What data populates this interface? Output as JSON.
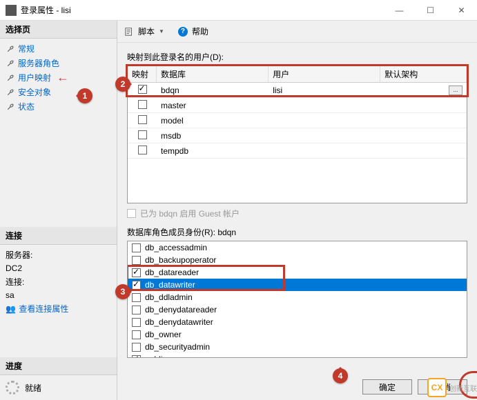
{
  "window": {
    "title": "登录属性 - lisi",
    "minimize": "—",
    "maximize": "☐",
    "close": "✕"
  },
  "left": {
    "select_page": "选择页",
    "nav": [
      {
        "label": "常规"
      },
      {
        "label": "服务器角色"
      },
      {
        "label": "用户映射"
      },
      {
        "label": "安全对象"
      },
      {
        "label": "状态"
      }
    ],
    "connection": "连接",
    "server_label": "服务器:",
    "server_value": "DC2",
    "conn_label": "连接:",
    "conn_value": "sa",
    "view_props": "查看连接属性",
    "progress": "进度",
    "ready": "就绪"
  },
  "toolbar": {
    "script": "脚本",
    "help": "帮助"
  },
  "content": {
    "mapped_users_label": "映射到此登录名的用户(D):",
    "grid_headers": {
      "map": "映射",
      "db": "数据库",
      "user": "用户",
      "schema": "默认架构"
    },
    "grid_rows": [
      {
        "checked": true,
        "db": "bdqn",
        "user": "lisi",
        "schema": "",
        "browse": true
      },
      {
        "checked": false,
        "db": "master",
        "user": "",
        "schema": ""
      },
      {
        "checked": false,
        "db": "model",
        "user": "",
        "schema": ""
      },
      {
        "checked": false,
        "db": "msdb",
        "user": "",
        "schema": ""
      },
      {
        "checked": false,
        "db": "tempdb",
        "user": "",
        "schema": ""
      }
    ],
    "guest_label": "已为 bdqn 启用 Guest 帐户",
    "role_label": "数据库角色成员身份(R): bdqn",
    "roles": [
      {
        "checked": false,
        "name": "db_accessadmin"
      },
      {
        "checked": false,
        "name": "db_backupoperator"
      },
      {
        "checked": true,
        "name": "db_datareader"
      },
      {
        "checked": true,
        "name": "db_datawriter",
        "selected": true
      },
      {
        "checked": false,
        "name": "db_ddladmin"
      },
      {
        "checked": false,
        "name": "db_denydatareader"
      },
      {
        "checked": false,
        "name": "db_denydatawriter"
      },
      {
        "checked": false,
        "name": "db_owner"
      },
      {
        "checked": false,
        "name": "db_securityadmin"
      },
      {
        "checked": true,
        "name": "public"
      }
    ]
  },
  "footer": {
    "ok": "确定",
    "cancel": "取消"
  },
  "annotations": {
    "b1": "1",
    "b2": "2",
    "b3": "3",
    "b4": "4"
  },
  "watermark": {
    "logo": "CX",
    "text": "创新互联"
  }
}
